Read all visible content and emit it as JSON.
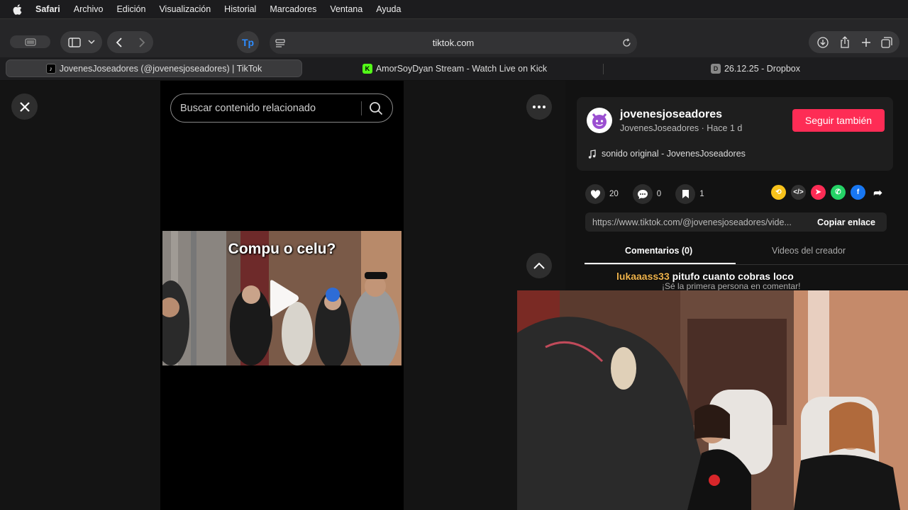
{
  "menubar": {
    "app": "Safari",
    "items": [
      "Archivo",
      "Edición",
      "Visualización",
      "Historial",
      "Marcadores",
      "Ventana",
      "Ayuda"
    ]
  },
  "toolbar": {
    "url": "tiktok.com"
  },
  "tabs": [
    {
      "title": "JovenesJoseadores (@jovenesjoseadores) | TikTok",
      "active": true
    },
    {
      "title": "AmorSoyDyan Stream - Watch Live on Kick",
      "active": false
    },
    {
      "title": "26.12.25 - Dropbox",
      "active": false
    }
  ],
  "search": {
    "placeholder": "Buscar contenido relacionado"
  },
  "video": {
    "caption": "Compu o celu?"
  },
  "author": {
    "username": "jovenesjoseadores",
    "display_name": "JovenesJoseadores",
    "separator": " · ",
    "time": "Hace 1 d",
    "follow_label": "Seguir también",
    "sound": "sonido original - JovenesJoseadores"
  },
  "stats": {
    "likes": "20",
    "comments": "0",
    "saves": "1"
  },
  "link": {
    "url": "https://www.tiktok.com/@jovenesjoseadores/vide...",
    "copy_label": "Copiar enlace"
  },
  "page_tabs": {
    "comments": "Comentarios (0)",
    "creator_videos": "Videos del creador"
  },
  "empty_comments": "¡Sé la primera persona en comentar!",
  "stream_chat": {
    "user": "lukaaass33",
    "message": "pitufo cuanto cobras loco"
  },
  "colors": {
    "follow": "#fe2c55",
    "chat_user": "#f0b44c",
    "kick_green": "#53fc18"
  }
}
